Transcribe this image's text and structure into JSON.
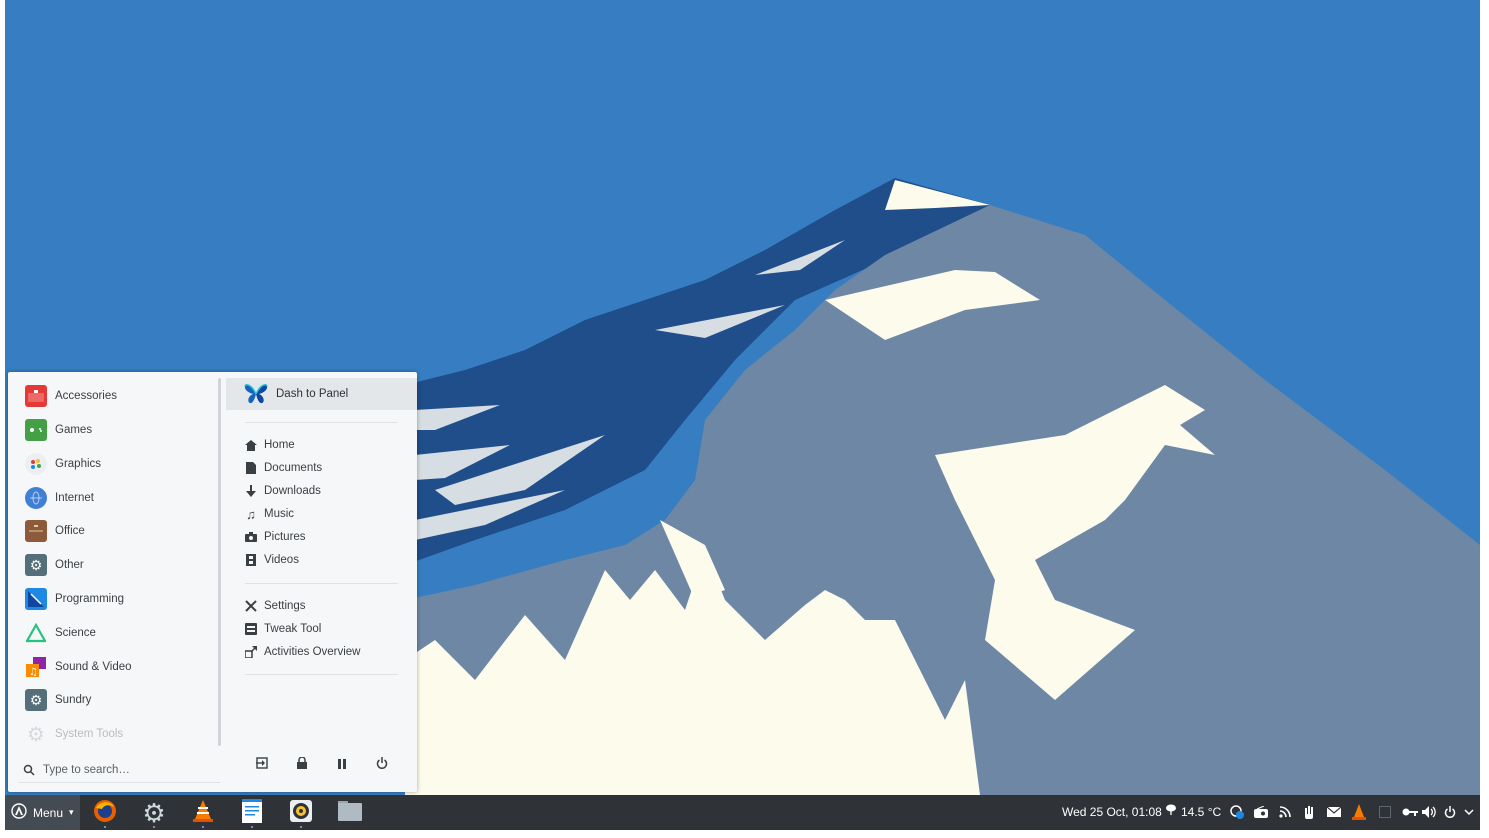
{
  "menu_button": {
    "label": "Menu"
  },
  "categories": [
    {
      "label": "Accessories",
      "icon": "toolbox-icon",
      "color": "#e53935"
    },
    {
      "label": "Games",
      "icon": "gamepad-icon",
      "color": "#43a047"
    },
    {
      "label": "Graphics",
      "icon": "palette-icon",
      "color": "#eceff1"
    },
    {
      "label": "Internet",
      "icon": "globe-icon",
      "color": "#3f7fd6"
    },
    {
      "label": "Office",
      "icon": "briefcase-icon",
      "color": "#8d5a3c"
    },
    {
      "label": "Other",
      "icon": "gear-icon",
      "color": "#546e7a"
    },
    {
      "label": "Programming",
      "icon": "code-icon",
      "color": "#1e88e5"
    },
    {
      "label": "Science",
      "icon": "flask-icon",
      "color": "#26c281"
    },
    {
      "label": "Sound & Video",
      "icon": "music-video-icon",
      "color": "#8e24aa"
    },
    {
      "label": "Sundry",
      "icon": "gear-icon",
      "color": "#546e7a"
    },
    {
      "label": "System Tools",
      "icon": "gear-icon",
      "color": "#cfd8dc"
    }
  ],
  "search": {
    "placeholder": "Type to search…"
  },
  "favorite": {
    "label": "Dash to Panel",
    "icon": "butterfly-icon"
  },
  "places": [
    {
      "label": "Home",
      "icon": "home-icon"
    },
    {
      "label": "Documents",
      "icon": "document-icon"
    },
    {
      "label": "Downloads",
      "icon": "download-icon"
    },
    {
      "label": "Music",
      "icon": "music-note-icon"
    },
    {
      "label": "Pictures",
      "icon": "camera-icon"
    },
    {
      "label": "Videos",
      "icon": "film-icon"
    }
  ],
  "system": [
    {
      "label": "Settings",
      "icon": "tools-icon"
    },
    {
      "label": "Tweak Tool",
      "icon": "tweak-icon"
    },
    {
      "label": "Activities Overview",
      "icon": "overview-icon"
    }
  ],
  "session": [
    "logout-icon",
    "lock-icon",
    "suspend-icon",
    "power-icon"
  ],
  "launchers": [
    "firefox-icon",
    "settings-gear-icon",
    "vlc-icon",
    "text-editor-icon",
    "rhythmbox-icon",
    "files-icon"
  ],
  "clock": "Wed 25 Oct, 01:08",
  "weather": {
    "temp": "14.5 °C",
    "icon": "cloud-rain-icon"
  },
  "tray": [
    "search-tray-icon",
    "radio-icon",
    "rss-icon",
    "hand-icon",
    "mail-icon",
    "vlc-tray-icon",
    "window-icon",
    "key-icon",
    "volume-icon",
    "power-tray-icon",
    "chevron-down-icon"
  ],
  "colors": {
    "sky": "#367ec1",
    "taskbar": "#2f3237",
    "menu_bg": "#f6f7f8",
    "mountain": "#6d87a5",
    "shadow": "#1f4e8a",
    "snow": "#fdfbec"
  }
}
